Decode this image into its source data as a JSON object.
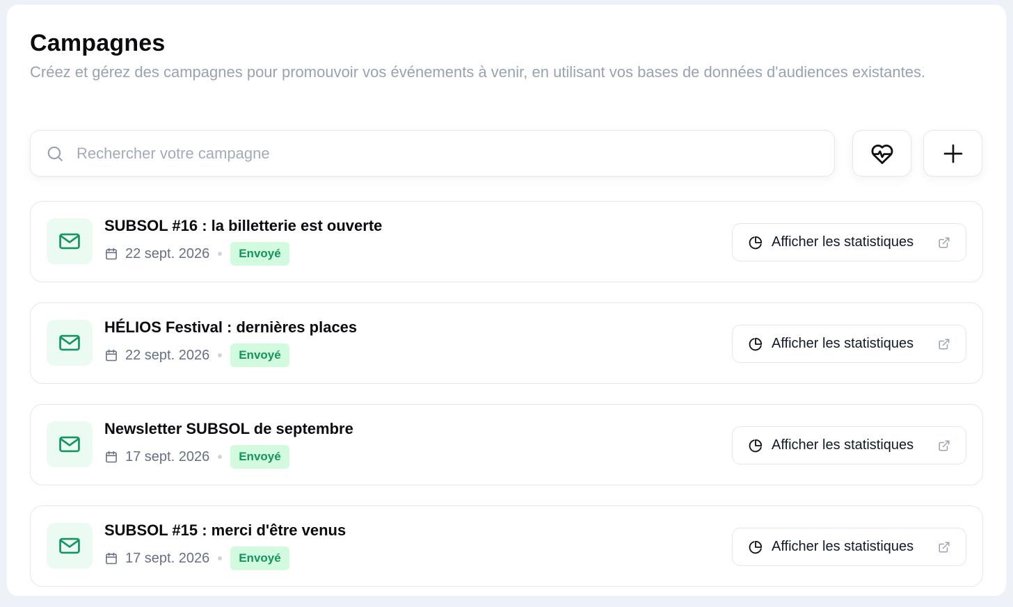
{
  "header": {
    "title": "Campagnes",
    "description": "Créez et gérez des campagnes pour promouvoir vos événements à venir, en utilisant vos bases de données d'audiences existantes."
  },
  "search": {
    "placeholder": "Rechercher votre campagne",
    "value": ""
  },
  "toolbar": {
    "health_icon": "heart-pulse-icon",
    "add_icon": "plus-icon"
  },
  "campaigns": [
    {
      "title": "SUBSOL #16 : la billetterie est ouverte",
      "date": "22 sept. 2026",
      "status": "Envoyé",
      "stats_label": "Afficher les statistiques"
    },
    {
      "title": "HÉLIOS Festival : dernières places",
      "date": "22 sept. 2026",
      "status": "Envoyé",
      "stats_label": "Afficher les statistiques"
    },
    {
      "title": "Newsletter SUBSOL de septembre",
      "date": "17 sept. 2026",
      "status": "Envoyé",
      "stats_label": "Afficher les statistiques"
    },
    {
      "title": "SUBSOL #15 : merci d'être venus",
      "date": "17 sept. 2026",
      "status": "Envoyé",
      "stats_label": "Afficher les statistiques"
    }
  ],
  "colors": {
    "accent_green": "#12955f",
    "badge_bg": "#d1fadf",
    "tile_bg": "#ebfbf2",
    "muted_text": "#98a2b3"
  }
}
